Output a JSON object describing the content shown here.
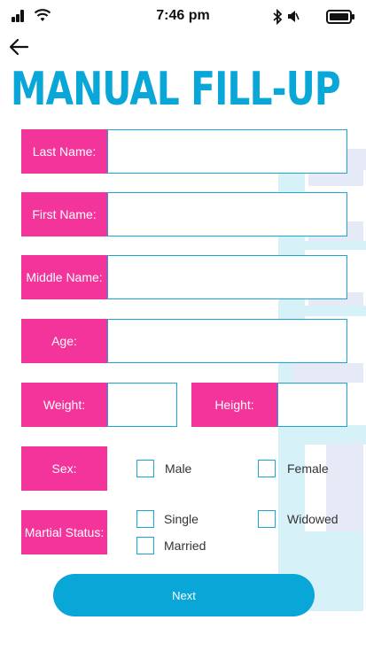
{
  "status_bar": {
    "time": "7:46 pm"
  },
  "title": "MANUAL FILL-UP",
  "fields": {
    "last_name": {
      "label": "Last Name:",
      "value": ""
    },
    "first_name": {
      "label": "First Name:",
      "value": ""
    },
    "middle_name": {
      "label": "Middle Name:",
      "value": ""
    },
    "age": {
      "label": "Age:",
      "value": ""
    },
    "weight": {
      "label": "Weight:",
      "value": ""
    },
    "height": {
      "label": "Height:",
      "value": ""
    }
  },
  "sex": {
    "label": "Sex:",
    "options": {
      "male": "Male",
      "female": "Female"
    }
  },
  "marital_status": {
    "label": "Martial Status:",
    "options": {
      "single": "Single",
      "widowed": "Widowed",
      "married": "Married"
    }
  },
  "next_label": "Next",
  "colors": {
    "accent": "#09a6d8",
    "label_bg": "#f3349a",
    "input_border": "#1aa6d4"
  },
  "icons": [
    "signal-icon",
    "wifi-icon",
    "bluetooth-icon",
    "speaker-icon",
    "battery-icon",
    "back-arrow-icon"
  ]
}
